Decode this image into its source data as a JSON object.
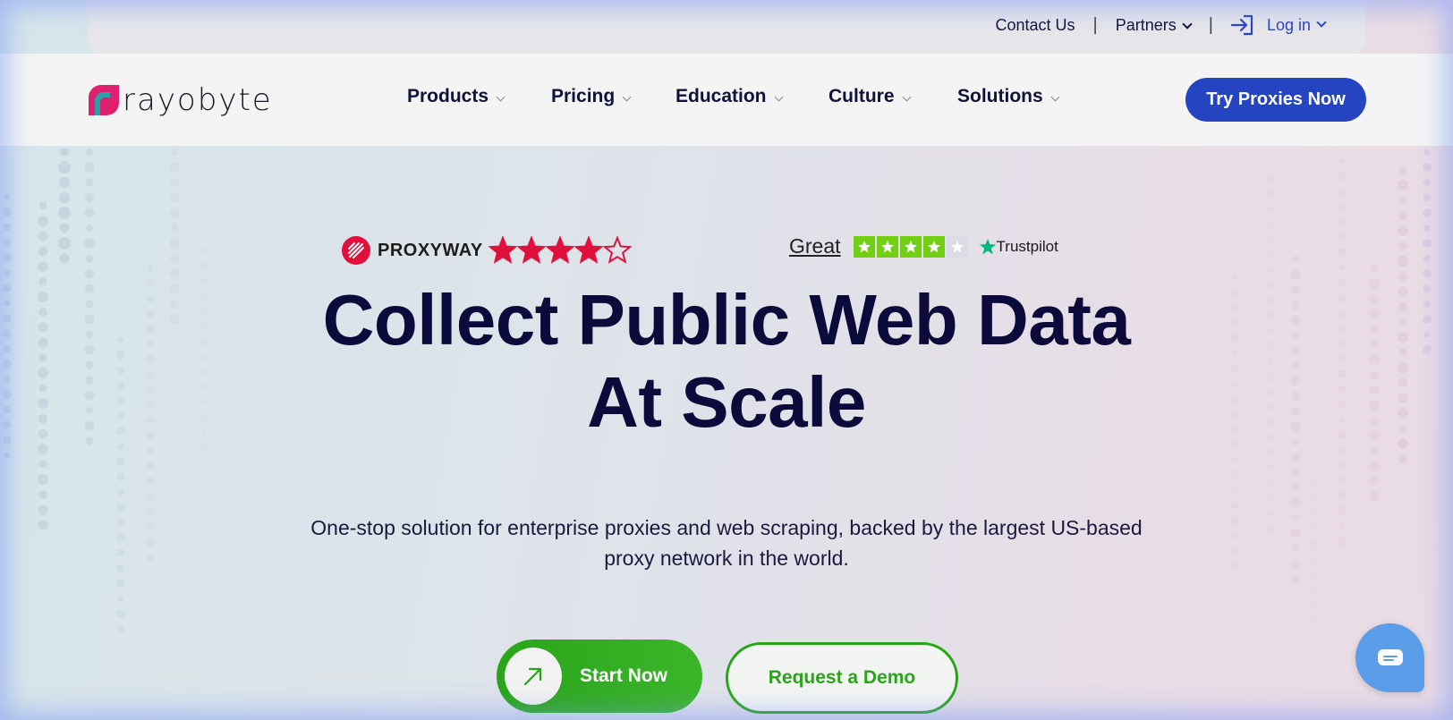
{
  "topbar": {
    "contact": "Contact Us",
    "separator": "|",
    "partners": "Partners",
    "login": "Log in"
  },
  "brand": {
    "name": "rayobyte"
  },
  "nav": {
    "items": [
      {
        "label": "Products"
      },
      {
        "label": "Pricing"
      },
      {
        "label": "Education"
      },
      {
        "label": "Culture"
      },
      {
        "label": "Solutions"
      }
    ],
    "cta": "Try Proxies Now"
  },
  "ratings": {
    "proxyway": {
      "name": "PROXYWAY",
      "stars": 4,
      "max_stars": 5
    },
    "trustpilot": {
      "rating_text": "Great",
      "stars": 4,
      "max_stars": 5,
      "brand": "Trustpilot"
    }
  },
  "hero": {
    "title_line1": "Collect Public Web Data",
    "title_line2": "At Scale",
    "subtitle_line1": "One-stop solution for enterprise proxies and web scraping, backed by the largest US-based",
    "subtitle_line2": "proxy network in the world.",
    "primary_cta": "Start Now",
    "secondary_cta": "Request a Demo"
  },
  "colors": {
    "accent_blue": "#2444c2",
    "cta_green": "#2aa51a",
    "proxyway_red": "#e0103a",
    "trustpilot_green": "#73cf11",
    "chat_blue": "#5b9de8"
  },
  "icons": {
    "login": "login-arrow-icon",
    "start": "arrow-up-right-icon",
    "chat": "chat-bubble-icon"
  }
}
